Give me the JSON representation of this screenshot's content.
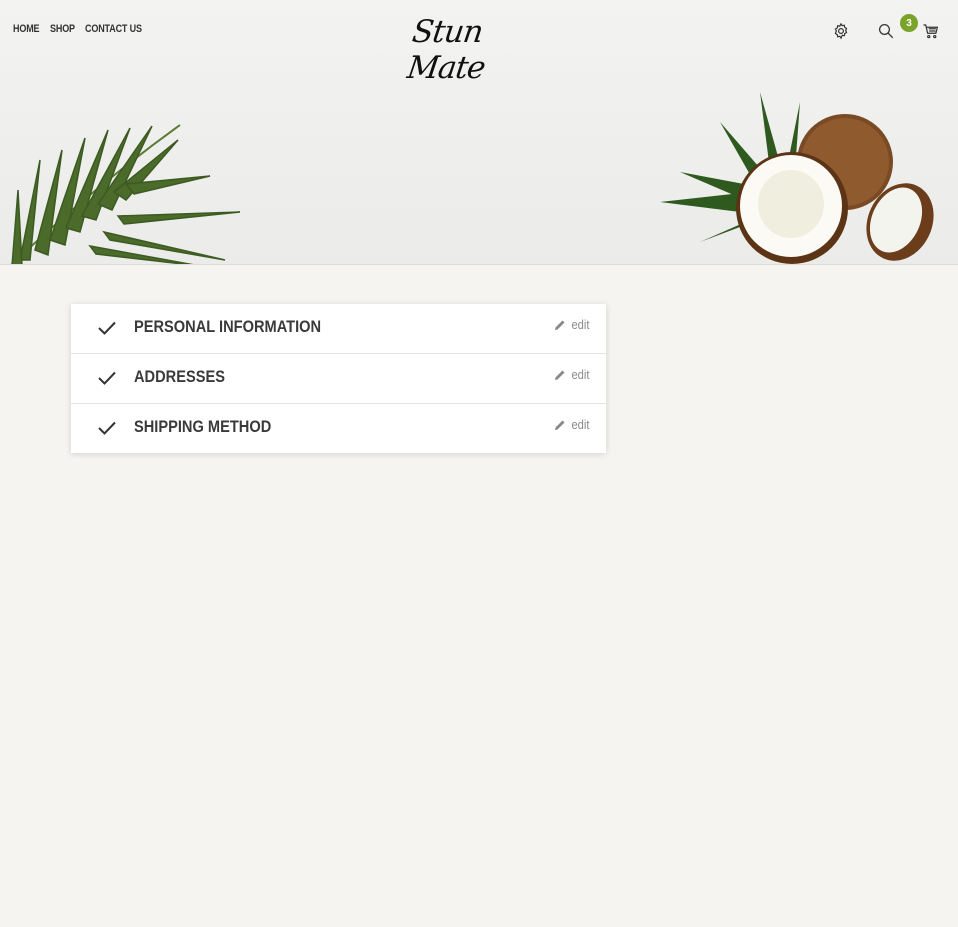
{
  "header": {
    "nav": [
      "HOME",
      "SHOP",
      "CONTACT US"
    ],
    "logo": "Stun Mate",
    "cart_count": "3",
    "icons": [
      "gear-icon",
      "search-icon",
      "cart-icon"
    ],
    "accent_color": "#7aa329"
  },
  "checkout": {
    "steps": [
      {
        "title": "PERSONAL INFORMATION",
        "action": "edit"
      },
      {
        "title": "ADDRESSES",
        "action": "edit"
      },
      {
        "title": "SHIPPING METHOD",
        "action": "edit"
      }
    ]
  }
}
